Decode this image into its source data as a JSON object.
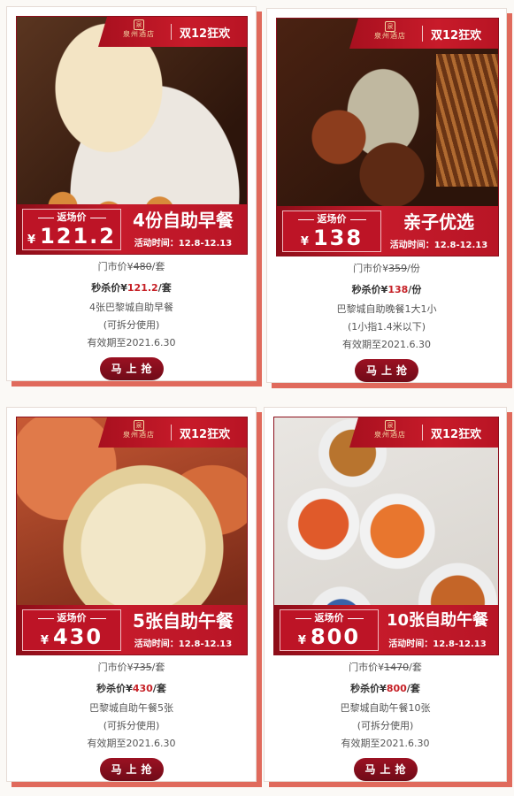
{
  "header_badge": "双12狂欢",
  "price_label": "返场价",
  "currency": "¥",
  "dates_label": "活动时间：12.8-12.13",
  "logo": {
    "text": "泉州酒店",
    "mark": "泉"
  },
  "retail_label": "门市价¥",
  "flash_label": "秒杀价¥",
  "button_label": "马上抢",
  "colors": {
    "primary": "#c81b2a",
    "dark": "#7a0b18",
    "accent": "#e06a5c"
  },
  "cards": [
    {
      "image": "breakfast-buffet-photo",
      "price": "121.2",
      "product": "4份自助早餐",
      "retail_price": "480",
      "retail_unit": "/套",
      "flash_price": "121.2",
      "flash_unit": "/套",
      "desc": [
        "4张巴黎城自助早餐",
        "(可拆分使用)",
        "有效期至2021.6.30"
      ]
    },
    {
      "image": "family-buffet-photo",
      "price": "138",
      "product": "亲子优选",
      "retail_price": "359",
      "retail_unit": "/份",
      "flash_price": "138",
      "flash_unit": "/份",
      "desc": [
        "巴黎城自助晚餐1大1小",
        "(1小指1.4米以下)",
        "有效期至2021.6.30"
      ]
    },
    {
      "image": "crab-lunch-photo",
      "price": "430",
      "product": "5张自助午餐",
      "retail_price": "735",
      "retail_unit": "/套",
      "flash_price": "430",
      "flash_unit": "/套",
      "desc": [
        "巴黎城自助午餐5张",
        "(可拆分使用)",
        "有效期至2021.6.30"
      ]
    },
    {
      "image": "seafood-lunch-photo",
      "price": "800",
      "product": "10张自助午餐",
      "retail_price": "1470",
      "retail_unit": "/套",
      "flash_price": "800",
      "flash_unit": "/套",
      "desc": [
        "巴黎城自助午餐10张",
        "(可拆分使用)",
        "有效期至2021.6.30"
      ]
    }
  ]
}
